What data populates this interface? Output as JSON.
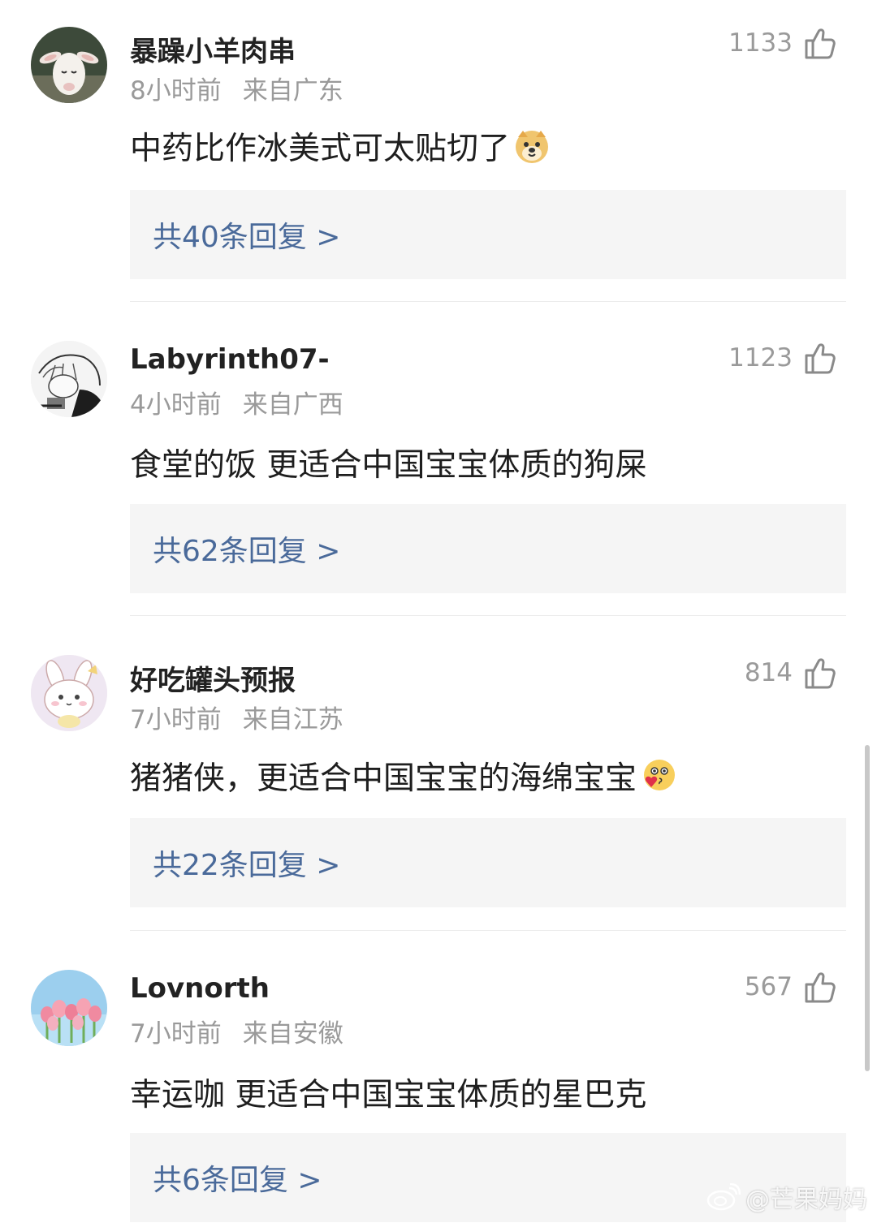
{
  "comments": [
    {
      "username": "暴躁小羊肉串",
      "time": "8小时前",
      "location": "来自广东",
      "likes": "1133",
      "text": "中药比作冰美式可太贴切了",
      "emoji": "doge-emoji",
      "replies": "共40条回复 >",
      "avatar": "goat-avatar"
    },
    {
      "username": "Labyrinth07-",
      "time": "4小时前",
      "location": "来自广西",
      "likes": "1123",
      "text": "食堂的饭 更适合中国宝宝体质的狗屎",
      "replies": "共62条回复 >",
      "avatar": "anime-sketch-avatar"
    },
    {
      "username": "好吃罐头预报",
      "time": "7小时前",
      "location": "来自江苏",
      "likes": "814",
      "text": "猪猪侠，更适合中国宝宝的海绵宝宝",
      "emoji": "heart-face-emoji",
      "replies": "共22条回复 >",
      "avatar": "bunny-cartoon-avatar"
    },
    {
      "username": "Lovnorth",
      "time": "7小时前",
      "location": "来自安徽",
      "likes": "567",
      "text": "幸运咖 更适合中国宝宝体质的星巴克",
      "replies": "共6条回复 >",
      "avatar": "tulips-avatar"
    }
  ],
  "watermark": "@芒果妈妈",
  "colors": {
    "reply_link": "#4a6a9a",
    "meta_gray": "#9a9a9a",
    "reply_bg": "#f5f5f5"
  }
}
